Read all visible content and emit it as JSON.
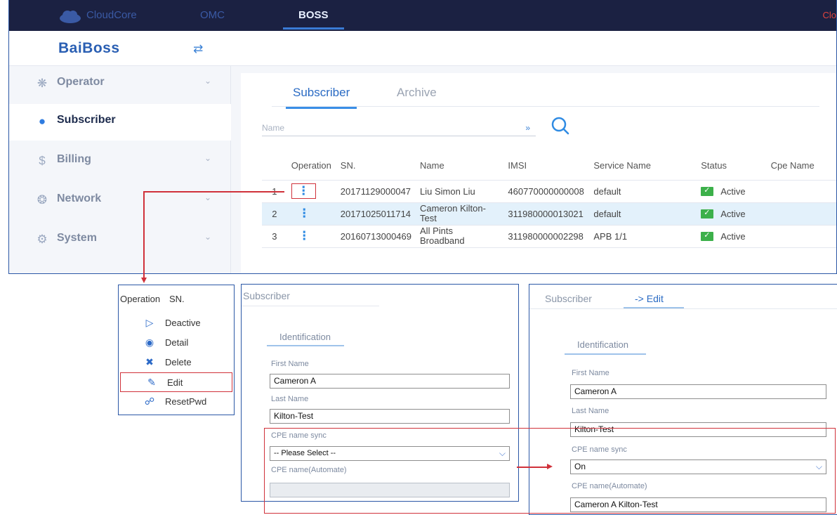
{
  "topbar": {
    "cloudcore_label": "CloudCore",
    "omc_label": "OMC",
    "boss_label": "BOSS",
    "right_text": "Clo"
  },
  "brand": {
    "name": "BaiBoss",
    "collapse_icon": "collapse-icon"
  },
  "sidebar": {
    "items": [
      {
        "label": "Operator",
        "icon": "operator-icon",
        "expandable": true
      },
      {
        "label": "Subscriber",
        "icon": "user-icon",
        "expandable": false,
        "active": true
      },
      {
        "label": "Billing",
        "icon": "dollar-icon",
        "expandable": true
      },
      {
        "label": "Network",
        "icon": "network-icon",
        "expandable": true
      },
      {
        "label": "System",
        "icon": "gears-icon",
        "expandable": true
      }
    ]
  },
  "main": {
    "tabs": [
      {
        "label": "Subscriber",
        "active": true
      },
      {
        "label": "Archive",
        "active": false
      }
    ],
    "filter": {
      "placeholder": "Name"
    },
    "table": {
      "headers": [
        "",
        "Operation",
        "SN.",
        "Name",
        "IMSI",
        "Service Name",
        "Status",
        "Cpe Name"
      ],
      "rows": [
        {
          "idx": "1",
          "sn": "20171129000047",
          "name": "Liu Simon Liu",
          "imsi": "460770000000008",
          "service": "default",
          "status": "Active",
          "cpe": ""
        },
        {
          "idx": "2",
          "sn": "20171025011714",
          "name": "Cameron Kilton-Test",
          "imsi": "311980000013021",
          "service": "default",
          "status": "Active",
          "cpe": "",
          "selected": true
        },
        {
          "idx": "3",
          "sn": "20160713000469",
          "name": "All Pints Broadband",
          "imsi": "311980000002298",
          "service": "APB 1/1",
          "status": "Active",
          "cpe": ""
        }
      ]
    }
  },
  "op_popup": {
    "header": {
      "operation": "Operation",
      "sn": "SN."
    },
    "items": [
      {
        "label": "Deactive",
        "icon": "play-circle-icon"
      },
      {
        "label": "Detail",
        "icon": "eye-icon"
      },
      {
        "label": "Delete",
        "icon": "delete-icon"
      },
      {
        "label": "Edit",
        "icon": "pencil-icon"
      },
      {
        "label": "ResetPwd",
        "icon": "lock-reset-icon"
      }
    ]
  },
  "form_before": {
    "title": "Subscriber",
    "subtab": "Identification",
    "first_name_label": "First Name",
    "first_name": "Cameron A",
    "last_name_label": "Last Name",
    "last_name": "Kilton-Test",
    "cpe_sync_label": "CPE name sync",
    "cpe_sync_value": "-- Please Select --",
    "cpe_name_label": "CPE name(Automate)",
    "cpe_name_value": ""
  },
  "form_after": {
    "title": "Subscriber",
    "title_edit": "-> Edit",
    "subtab": "Identification",
    "first_name_label": "First Name",
    "first_name": "Cameron A",
    "last_name_label": "Last Name",
    "last_name": "Kilton-Test",
    "cpe_sync_label": "CPE name sync",
    "cpe_sync_value": "On",
    "cpe_name_label": "CPE name(Automate)",
    "cpe_name_value": "Cameron A Kilton-Test"
  },
  "colors": {
    "topbar_bg": "#1b2142",
    "accent": "#2f7ce0",
    "annotation_red": "#d0313a",
    "active_green": "#3cb04a",
    "selected_row": "#e3f1fb"
  }
}
